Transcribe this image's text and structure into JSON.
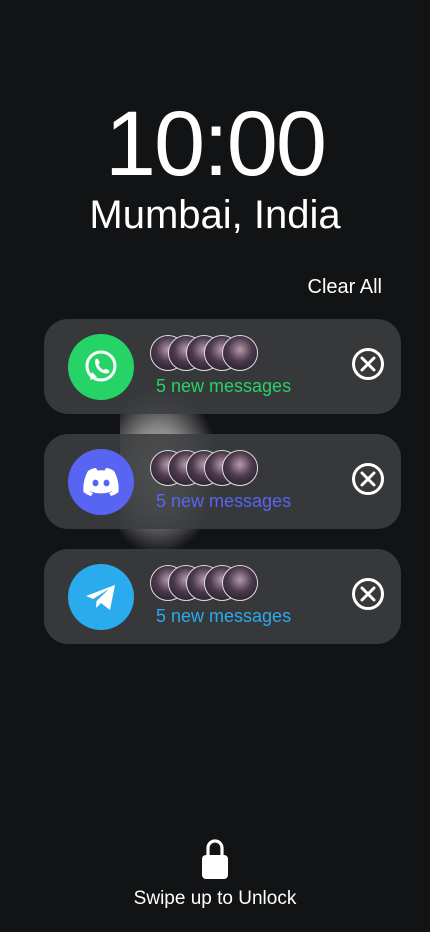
{
  "lockscreen": {
    "time": "10:00",
    "location": "Mumbai, India",
    "clear_all": "Clear All",
    "unlock_text": "Swipe up to Unlock"
  },
  "notifications": [
    {
      "app": "WhatsApp",
      "icon": "whatsapp-icon",
      "color": "#25D366",
      "message": "5 new messages"
    },
    {
      "app": "Discord",
      "icon": "discord-icon",
      "color": "#5865F2",
      "message": "5 new messages"
    },
    {
      "app": "Telegram",
      "icon": "telegram-icon",
      "color": "#2AABEE",
      "message": "5 new messages"
    }
  ],
  "colors": {
    "background": "#121315",
    "card": "#3c3d40",
    "text": "#ffffff"
  }
}
